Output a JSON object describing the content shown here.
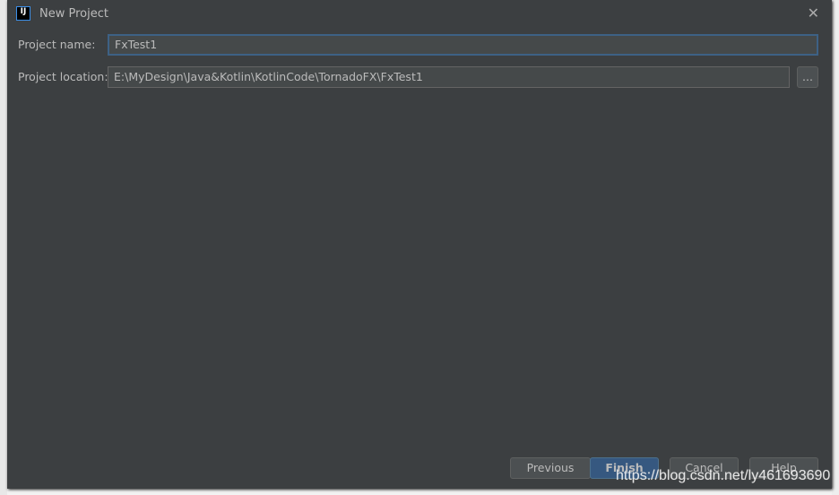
{
  "dialog": {
    "title": "New Project",
    "icon": "intellij-logo",
    "close_icon": "close-icon"
  },
  "form": {
    "name_label": "Project name:",
    "name_value": "FxTest1",
    "location_label": "Project location:",
    "location_value": "E:\\MyDesign\\Java&Kotlin\\KotlinCode\\TornadoFX\\FxTest1",
    "browse_label": "..."
  },
  "buttons": {
    "previous": "Previous",
    "finish": "Finish",
    "cancel": "Cancel",
    "help": "Help"
  },
  "watermark": "https://blog.csdn.net/ly461693690"
}
